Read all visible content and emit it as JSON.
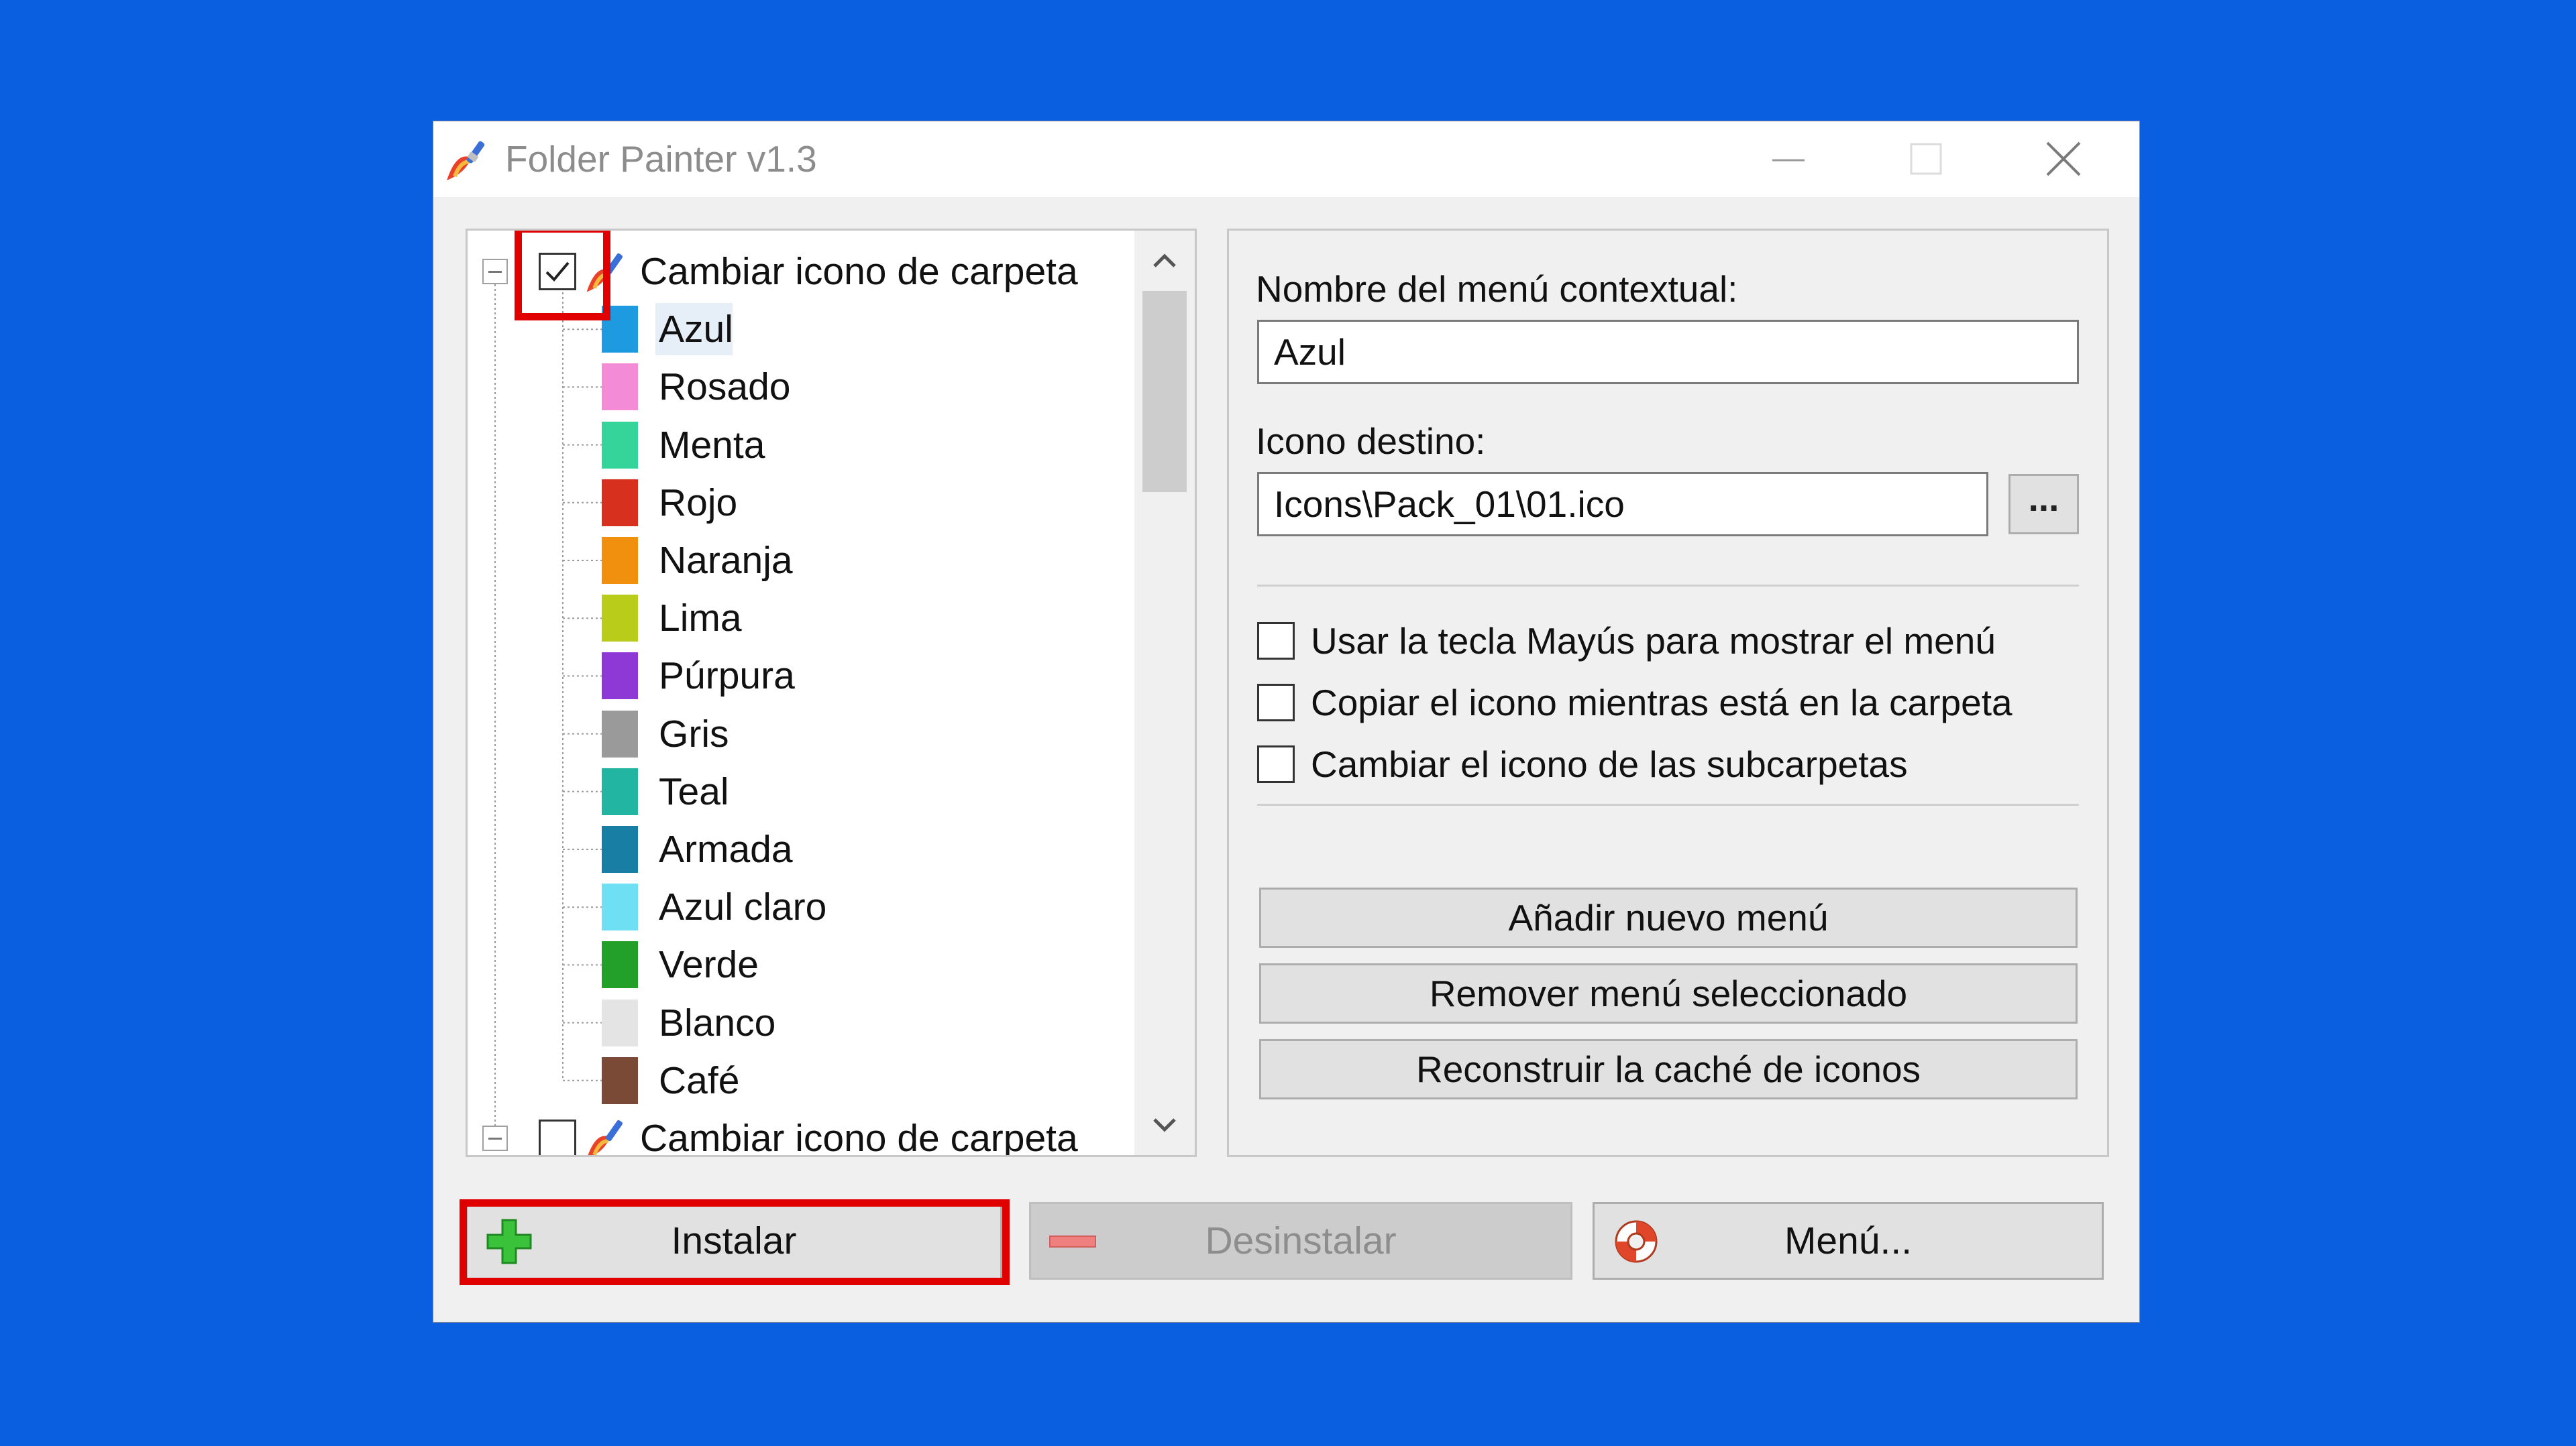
{
  "window": {
    "title": "Folder Painter v1.3"
  },
  "tree": {
    "groups": [
      {
        "label": "Cambiar icono de carpeta",
        "checked": true,
        "expanded": true,
        "items": [
          {
            "label": "Azul",
            "color": "#1e9be0",
            "selected": true
          },
          {
            "label": "Rosado",
            "color": "#f38bd6"
          },
          {
            "label": "Menta",
            "color": "#34d49a"
          },
          {
            "label": "Rojo",
            "color": "#d8301f"
          },
          {
            "label": "Naranja",
            "color": "#f0900e"
          },
          {
            "label": "Lima",
            "color": "#b9cc1a"
          },
          {
            "label": "Púrpura",
            "color": "#8e39d6"
          },
          {
            "label": "Gris",
            "color": "#9a9a9a"
          },
          {
            "label": "Teal",
            "color": "#22b5a2"
          },
          {
            "label": "Armada",
            "color": "#187ea3"
          },
          {
            "label": "Azul claro",
            "color": "#6fe0f4"
          },
          {
            "label": "Verde",
            "color": "#22a02a"
          },
          {
            "label": "Blanco",
            "color": "#e4e4e4"
          },
          {
            "label": "Café",
            "color": "#7a4a36"
          }
        ]
      },
      {
        "label": "Cambiar icono de carpeta",
        "checked": false,
        "expanded": true,
        "items": []
      }
    ]
  },
  "props": {
    "menu_name_label": "Nombre del menú contextual:",
    "menu_name_value": "Azul",
    "icon_label": "Icono destino:",
    "icon_value": "Icons\\Pack_01\\01.ico",
    "browse_label": "...",
    "options": [
      {
        "label": "Usar la tecla Mayús para mostrar el menú",
        "checked": false
      },
      {
        "label": "Copiar el icono mientras está en la carpeta",
        "checked": false
      },
      {
        "label": "Cambiar el icono de las subcarpetas",
        "checked": false
      }
    ],
    "buttons": {
      "add": "Añadir nuevo menú",
      "remove": "Remover menú seleccionado",
      "rebuild": "Reconstruir la caché de iconos"
    }
  },
  "bottom": {
    "install": "Instalar",
    "uninstall": "Desinstalar",
    "menu": "Menú..."
  },
  "colors": {
    "background": "#0a5fe0",
    "highlight": "#e00000"
  }
}
